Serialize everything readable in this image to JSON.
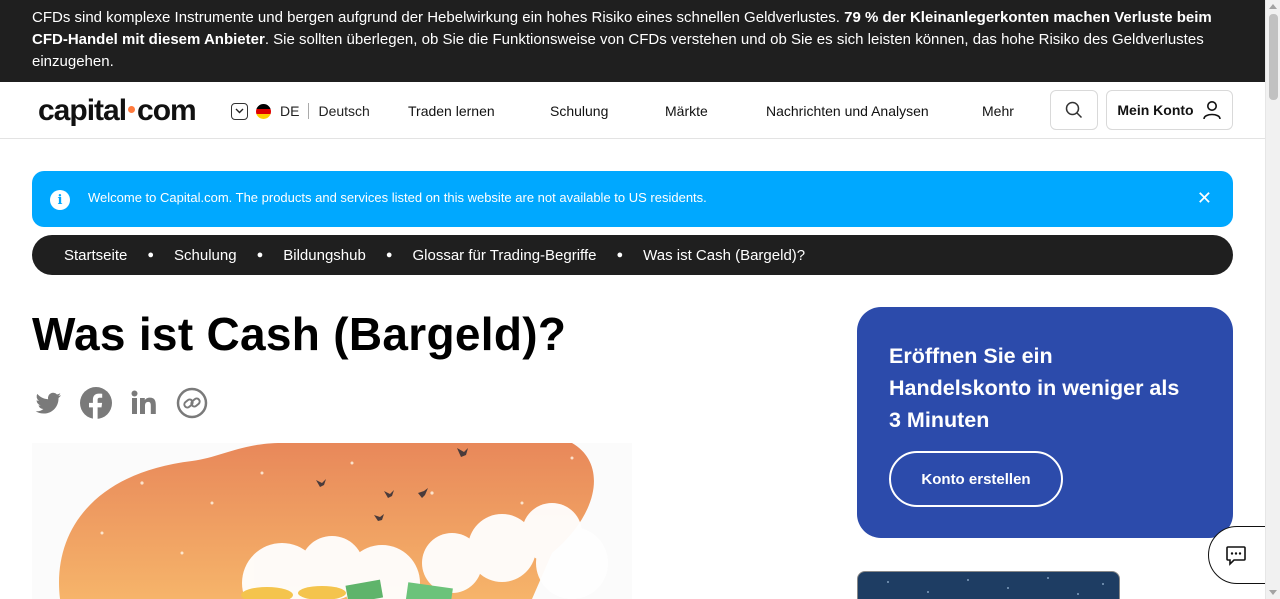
{
  "risk_banner": {
    "text_start": "CFDs sind komplexe Instrumente und bergen aufgrund der Hebelwirkung ein hohes Risiko eines schnellen Geldverlustes.",
    "text_bold": "79 % der Kleinanlegerkonten machen Verluste beim CFD-Handel mit diesem Anbieter",
    "text_end": ". Sie sollten überlegen, ob Sie die Funktionsweise von CFDs verstehen und ob Sie es sich leisten können, das hohe Risiko des Geldverlustes einzugehen."
  },
  "header": {
    "logo_left": "capital",
    "logo_right": "com",
    "lang_code": "DE",
    "lang_name": "Deutsch",
    "nav": [
      "Traden lernen",
      "Schulung",
      "Märkte",
      "Nachrichten und Analysen",
      "Mehr"
    ],
    "account_label": "Mein Konto"
  },
  "alert": {
    "icon": "info-icon",
    "message": "Welcome to Capital.com. The products and services listed on this website are not available to US residents.",
    "close": "✕"
  },
  "breadcrumb": [
    "Startseite",
    "Schulung",
    "Bildungshub",
    "Glossar für Trading-Begriffe",
    "Was ist Cash (Bargeld)?"
  ],
  "page": {
    "title": "Was ist Cash (Bargeld)?"
  },
  "share_icons": [
    "twitter-icon",
    "facebook-icon",
    "linkedin-icon",
    "link-icon"
  ],
  "cta": {
    "heading": "Eröffnen Sie ein Handelskonto in weniger als 3 Minuten",
    "button": "Konto erstellen"
  },
  "colors": {
    "banner_bg": "#1f1f1f",
    "alert_bg": "#00a8ff",
    "cta_bg": "#2c4bab",
    "logo_dot": "#ff7a3d"
  }
}
